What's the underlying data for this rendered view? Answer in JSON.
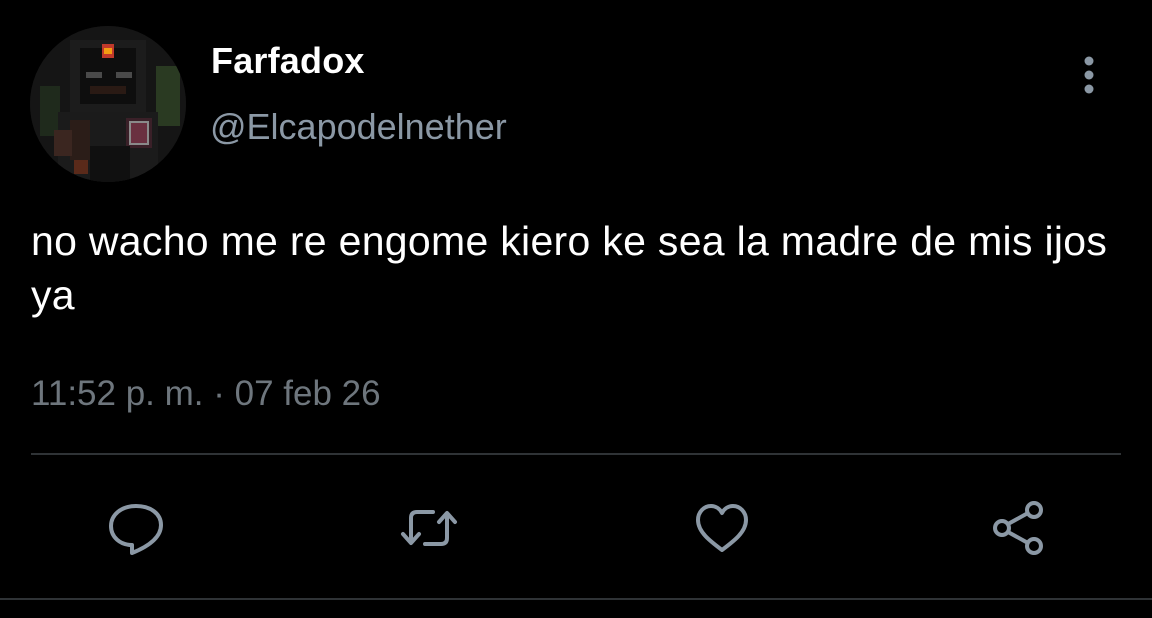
{
  "user": {
    "display_name": "Farfadox",
    "handle": "@Elcapodelnether",
    "avatar_icon": "minecraft-skin-avatar"
  },
  "tweet": {
    "text": "no wacho me re engome kiero ke sea la madre de mis ijos ya",
    "time": "11:52 p. m.",
    "separator": "·",
    "date": "07 feb 26"
  },
  "actions": {
    "reply_icon": "speech-bubble-icon",
    "retweet_icon": "retweet-icon",
    "like_icon": "heart-icon",
    "share_icon": "share-icon",
    "more_icon": "vertical-dots-icon"
  },
  "colors": {
    "background": "#000000",
    "text_primary": "#ffffff",
    "text_secondary": "#8b98a5",
    "text_meta": "#6e767d",
    "icon": "#8b98a5",
    "divider": "#2f3336"
  }
}
